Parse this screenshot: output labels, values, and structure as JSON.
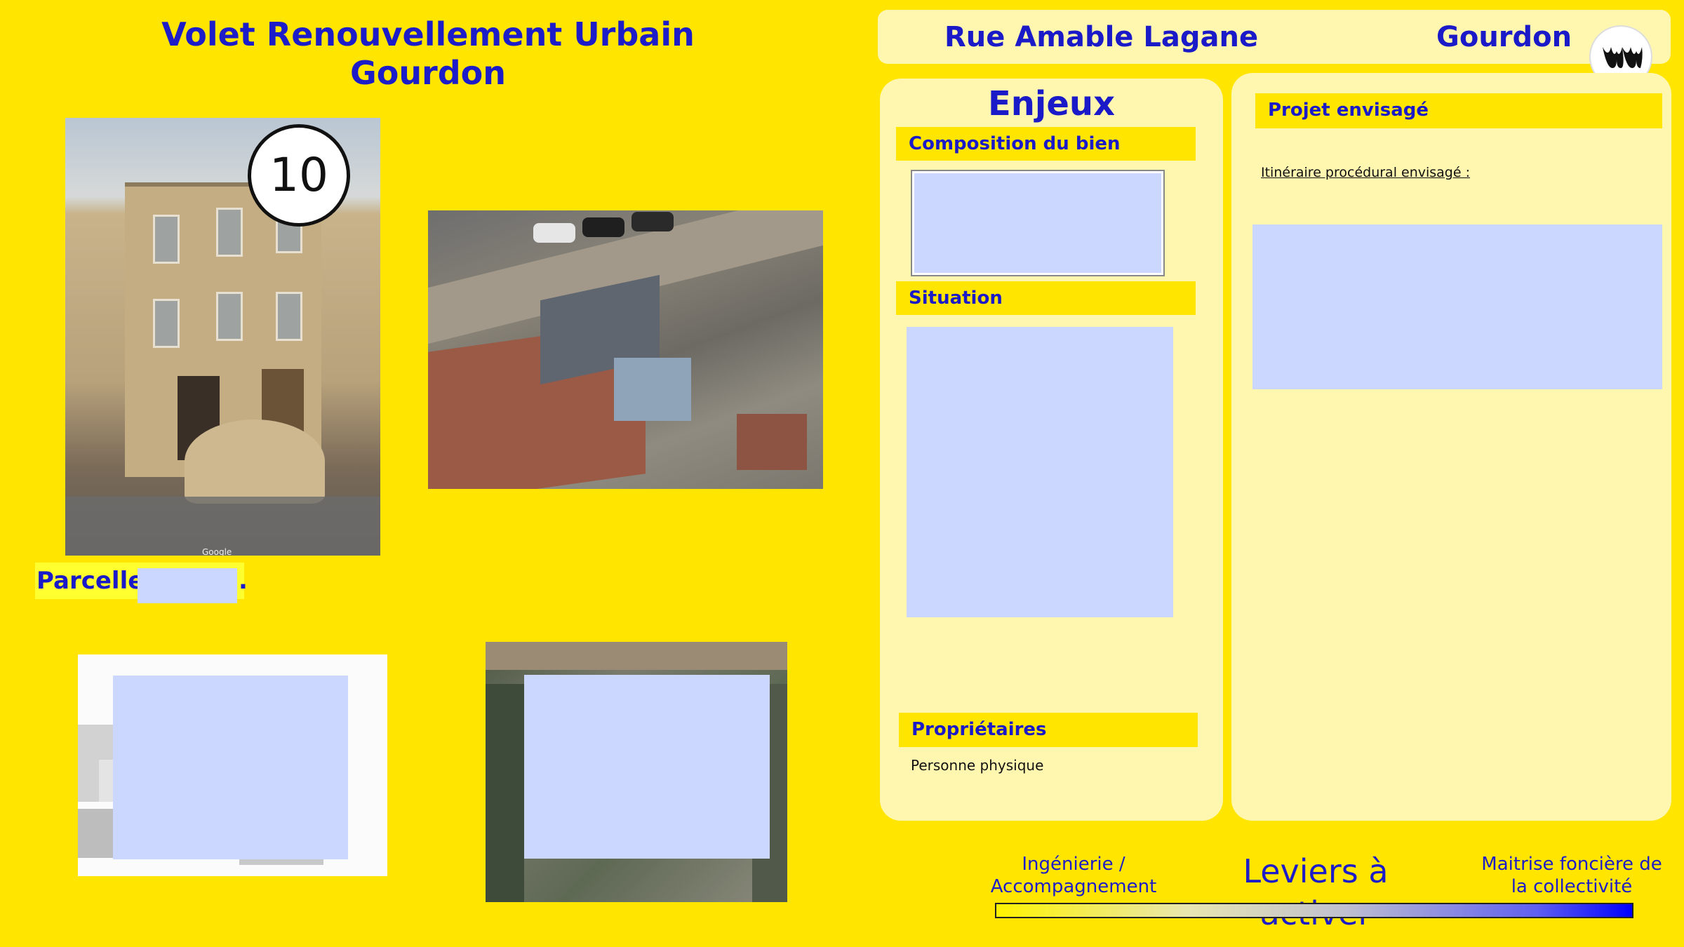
{
  "title": {
    "line1": "Volet Renouvellement Urbain",
    "line2": "Gourdon"
  },
  "badge_number": "10",
  "parcelle_label": "Parcelle",
  "parcelle_suffix": ".",
  "photo_watermark": "Google",
  "header": {
    "street": "Rue Amable Lagane",
    "city": "Gourdon"
  },
  "enjeux": {
    "title": "Enjeux",
    "composition_label": "Composition du bien",
    "situation_label": "Situation",
    "proprietaires_label": "Propriétaires",
    "proprietaires_value": "Personne physique"
  },
  "projet": {
    "label": "Projet envisagé",
    "itineraire_label": "Itinéraire procédural envisagé :"
  },
  "leviers": {
    "left": "Ingénierie / Accompagnement",
    "title": "Leviers à activer",
    "right": "Maitrise foncière de la collectivité"
  },
  "colors": {
    "background": "#FFE500",
    "panel": "#FFF6B0",
    "text_blue": "#1C1CC8",
    "redaction": "#CBD7FF"
  },
  "icons": [
    "logo-icon"
  ]
}
